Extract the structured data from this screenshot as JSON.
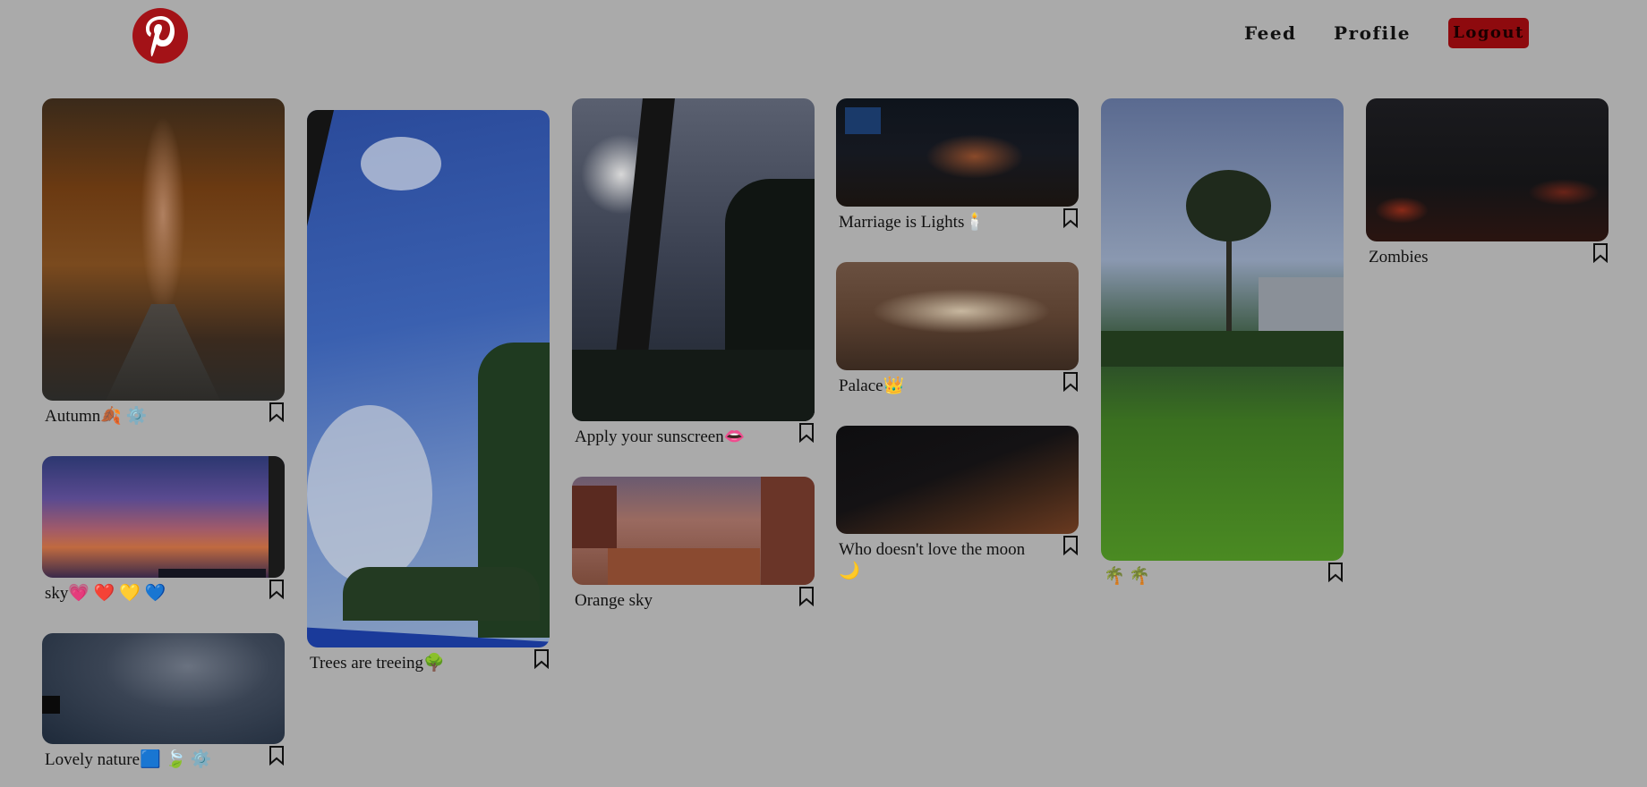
{
  "nav": {
    "feed": "Feed",
    "profile": "Profile",
    "logout": "Logout"
  },
  "pins": {
    "autumn": "Autumn🍂 ⚙️",
    "sky": "sky💗 ❤️ 💛 💙",
    "lovely": "Lovely nature🟦 🍃 ⚙️",
    "trees": "Trees are treeing🌳",
    "sunscreen": "Apply your sunscreen👄",
    "orange": "Orange sky",
    "marriage": "Marriage is Lights🕯️",
    "palace": "Palace👑",
    "moon": "Who doesn't love the moon 🌙",
    "palms": "🌴 🌴",
    "zombies": "Zombies"
  },
  "icons": {
    "logo": "pinterest-logo",
    "save": "bookmark-icon"
  },
  "colors": {
    "brand": "#a31217",
    "background": "#aaaaaa"
  }
}
